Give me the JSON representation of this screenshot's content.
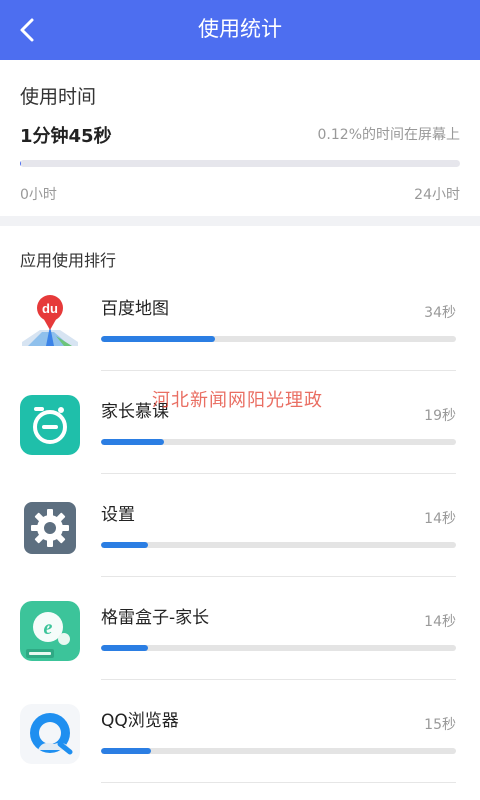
{
  "header": {
    "title": "使用统计",
    "back_icon": "chevron-left-icon",
    "color": "#4d6ef0"
  },
  "usage": {
    "label": "使用时间",
    "duration": "1分钟45秒",
    "percent_text": "0.12%的时间在屏幕上",
    "screen_fraction": 0.0012,
    "axis_min": "0小时",
    "axis_max": "24小时"
  },
  "ranking": {
    "title": "应用使用排行",
    "bar_color": "#2b7ee3",
    "apps": [
      {
        "name": "百度地图",
        "time": "34秒",
        "seconds": 34,
        "icon": "baidu-map-icon"
      },
      {
        "name": "家长慕课",
        "time": "19秒",
        "seconds": 19,
        "icon": "parent-mooc-icon"
      },
      {
        "name": "设置",
        "time": "14秒",
        "seconds": 14,
        "icon": "settings-gear-icon"
      },
      {
        "name": "格雷盒子-家长",
        "time": "14秒",
        "seconds": 14,
        "icon": "gray-box-parent-icon"
      },
      {
        "name": "QQ浏览器",
        "time": "15秒",
        "seconds": 15,
        "icon": "qq-browser-icon"
      }
    ]
  },
  "watermark": {
    "text": "河北新闻网阳光理政"
  }
}
